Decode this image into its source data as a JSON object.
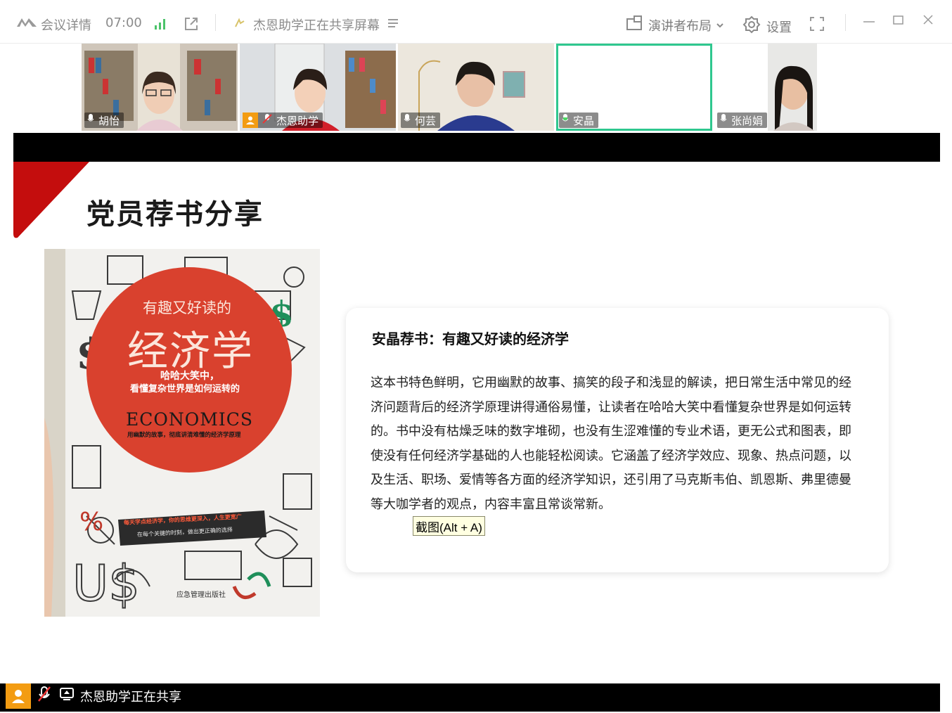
{
  "topbar": {
    "meeting_title": "会议详情",
    "time": "07:00",
    "share_status": "杰恩助学正在共享屏幕",
    "layout_label": "演讲者布局",
    "settings_label": "设置",
    "icons": [
      "logo-icon",
      "signal-icon",
      "external-link-icon",
      "sharing-icon",
      "list-icon",
      "layout-icon",
      "chevron-down-icon",
      "gear-icon",
      "fullscreen-icon",
      "minimize-icon",
      "maximize-icon",
      "close-icon"
    ]
  },
  "participants": [
    {
      "name": "胡怡"
    },
    {
      "name": "杰恩助学"
    },
    {
      "name": "何芸"
    },
    {
      "name": "安晶"
    },
    {
      "name": "张尚娟"
    }
  ],
  "slide": {
    "title": "党员荐书分享",
    "book": {
      "title_line1": "有趣又好读的",
      "title_main": "经济学",
      "subtitle1": "哈哈大笑中，",
      "subtitle2": "看懂复杂世界是如何运转的",
      "econ": "ECONOMICS",
      "tagline": "用幽默的故事，彻底讲清难懂的经济学原理",
      "banner1": "每天学点经济学，你的思维更深入，人生更宽广",
      "banner2": "在每个关键的时刻，做出更正确的选择",
      "publisher": "应急管理出版社"
    },
    "card_title": "安晶荐书：有趣又好读的经济学",
    "card_body": "这本书特色鲜明，它用幽默的故事、搞笑的段子和浅显的解读，把日常生活中常见的经济问题背后的经济学原理讲得通俗易懂，让读者在哈哈大笑中看懂复杂世界是如何运转的。书中没有枯燥乏味的数字堆砌，也没有生涩难懂的专业术语，更无公式和图表，即使没有任何经济学基础的人也能轻松阅读。它涵盖了经济学效应、现象、热点问题，以及生活、职场、爱情等各方面的经济学知识，还引用了马克斯韦伯、凯恩斯、弗里德曼等大咖学者的观点，内容丰富且常谈常新。"
  },
  "tooltip": "截图(Alt + A)",
  "status_bar": {
    "sharer_text": "杰恩助学正在共享"
  },
  "colors": {
    "accent_green": "#2fc78f",
    "slide_red": "#c40d0d",
    "badge_orange": "#f39c12"
  }
}
